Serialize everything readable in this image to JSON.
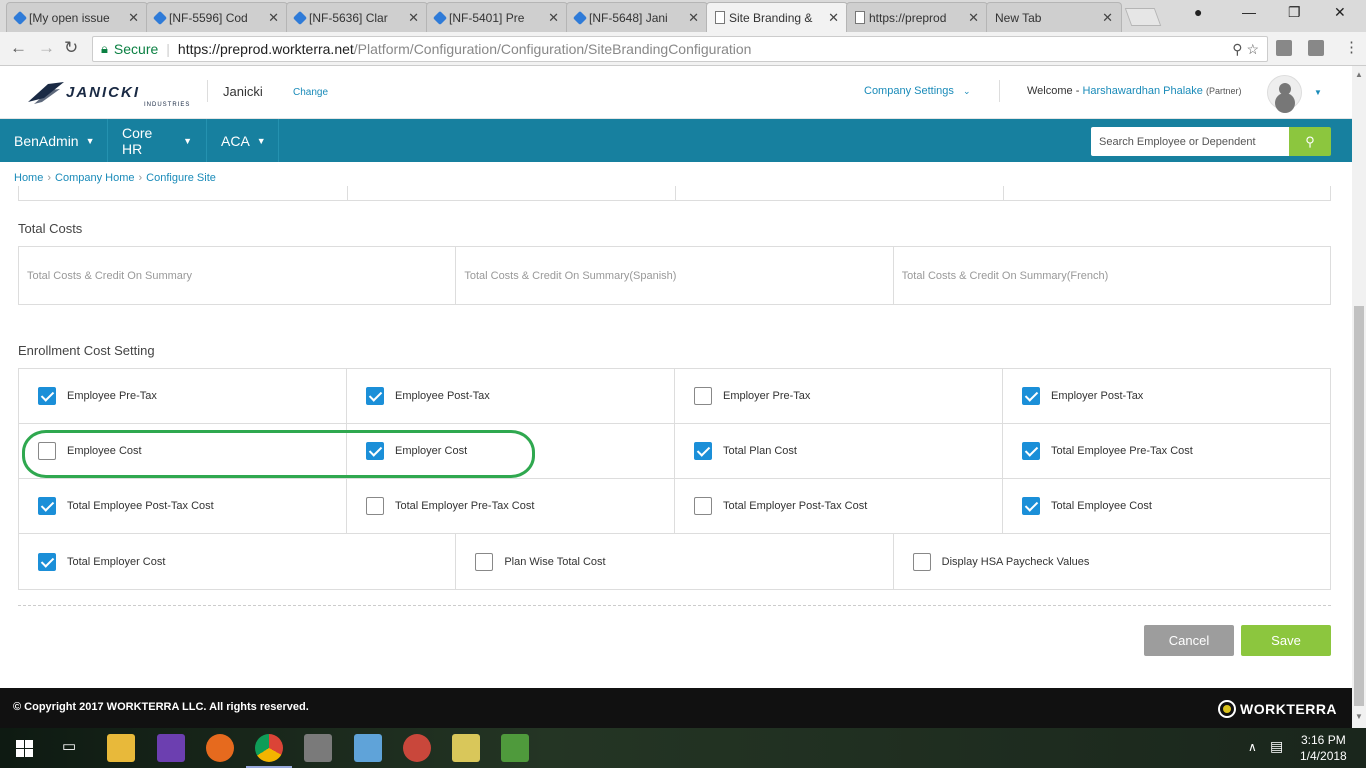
{
  "browser": {
    "tabs": [
      {
        "label": "[My open issue",
        "icon": "jira-icon",
        "active": false
      },
      {
        "label": "[NF-5596] Cod",
        "icon": "jira-icon",
        "active": false
      },
      {
        "label": "[NF-5636] Clar",
        "icon": "jira-icon",
        "active": false
      },
      {
        "label": "[NF-5401] Pre",
        "icon": "jira-icon",
        "active": false
      },
      {
        "label": "[NF-5648] Jani",
        "icon": "jira-icon",
        "active": false
      },
      {
        "label": "Site Branding &",
        "icon": "page-icon",
        "active": true
      },
      {
        "label": "https://preprod",
        "icon": "page-icon",
        "active": false
      },
      {
        "label": "New Tab",
        "icon": "none",
        "active": false
      }
    ],
    "secure_label": "Secure",
    "url_host": "https://preprod.workterra.net",
    "url_path": "/Platform/Configuration/Configuration/SiteBrandingConfiguration"
  },
  "header": {
    "logo_text": "JANICKI",
    "logo_sub": "INDUSTRIES",
    "company": "Janicki",
    "change_label": "Change",
    "company_settings": "Company Settings",
    "welcome": "Welcome -",
    "user_name": "Harshawardhan Phalake",
    "user_role": "(Partner)"
  },
  "nav": {
    "items": [
      "BenAdmin",
      "Core HR",
      "ACA"
    ],
    "search_placeholder": "Search Employee or Dependent"
  },
  "breadcrumb": [
    "Home",
    "Company Home",
    "Configure Site"
  ],
  "total_costs": {
    "title": "Total Costs",
    "placeholders": [
      "Total Costs & Credit On Summary",
      "Total Costs & Credit On Summary(Spanish)",
      "Total Costs & Credit On Summary(French)"
    ]
  },
  "enrollment": {
    "title": "Enrollment Cost Setting",
    "rows": [
      [
        {
          "label": "Employee Pre-Tax",
          "checked": true
        },
        {
          "label": "Employee Post-Tax",
          "checked": true
        },
        {
          "label": "Employer Pre-Tax",
          "checked": false
        },
        {
          "label": "Employer Post-Tax",
          "checked": true
        }
      ],
      [
        {
          "label": "Employee Cost",
          "checked": false
        },
        {
          "label": "Employer Cost",
          "checked": true
        },
        {
          "label": "Total Plan Cost",
          "checked": true
        },
        {
          "label": "Total Employee Pre-Tax Cost",
          "checked": true
        }
      ],
      [
        {
          "label": "Total Employee Post-Tax Cost",
          "checked": true
        },
        {
          "label": "Total Employer Pre-Tax Cost",
          "checked": false
        },
        {
          "label": "Total Employer Post-Tax Cost",
          "checked": false
        },
        {
          "label": "Total Employee Cost",
          "checked": true
        }
      ],
      [
        {
          "label": "Total Employer Cost",
          "checked": true
        },
        {
          "label": "Plan Wise Total Cost",
          "checked": false
        },
        {
          "label": "Display HSA Paycheck Values",
          "checked": false
        }
      ]
    ]
  },
  "actions": {
    "cancel": "Cancel",
    "save": "Save"
  },
  "footer": {
    "copyright": "© Copyright 2017 WORKTERRA LLC. All rights reserved.",
    "brand": "WORKTERRA"
  },
  "taskbar": {
    "time": "3:16 PM",
    "date": "1/4/2018"
  },
  "colors": {
    "nav_bg": "#17809f",
    "accent_green": "#8cc63e",
    "link_blue": "#1a8bb9",
    "checkbox_blue": "#1b8fd8",
    "highlight_green": "#2fa84f"
  }
}
